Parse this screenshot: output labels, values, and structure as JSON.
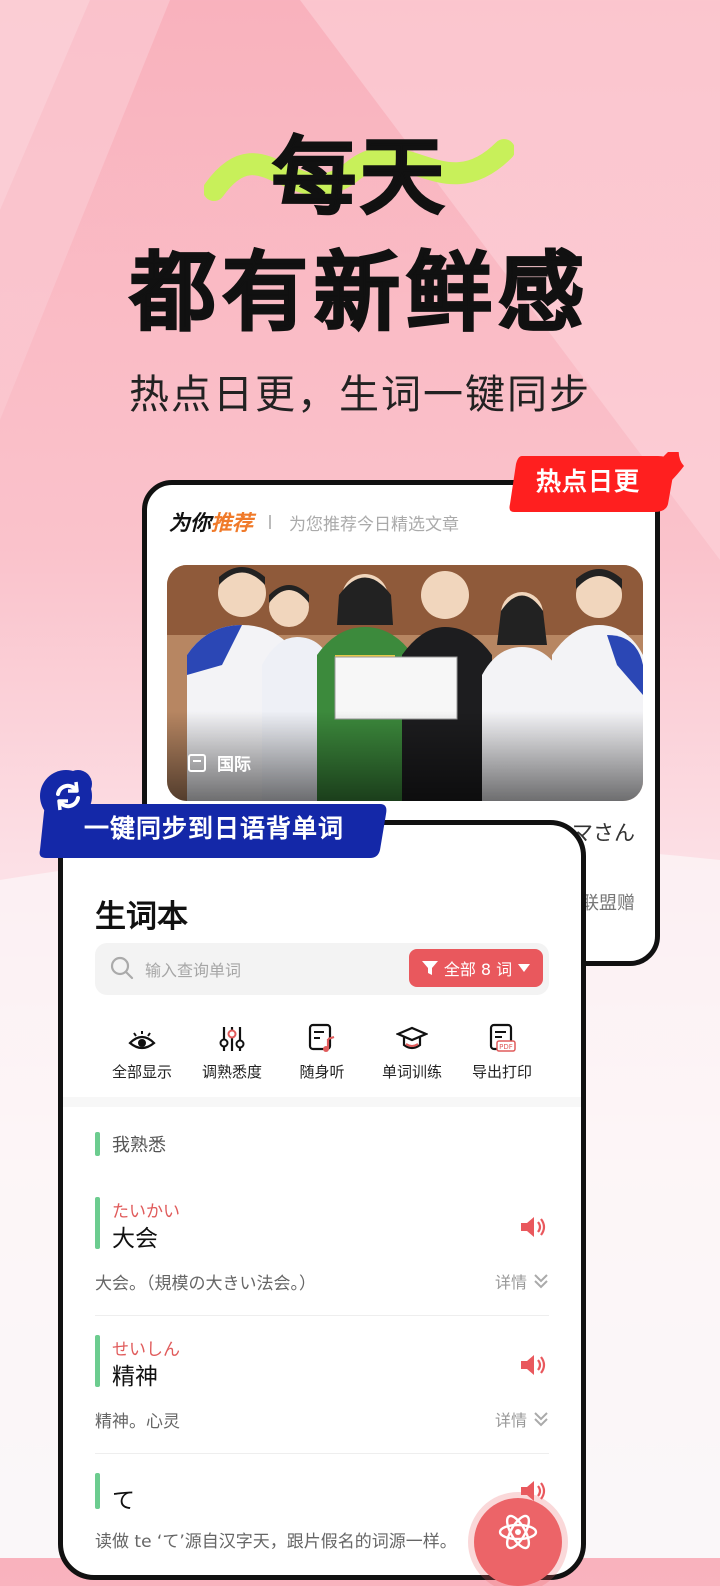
{
  "hero": {
    "line1": "每天",
    "line2": "都有新鲜感",
    "subtitle": "热点日更，生词一键同步"
  },
  "badges": {
    "hot": "热点日更",
    "sync": "一键同步到日语背单词"
  },
  "recommend": {
    "title_a": "为你",
    "title_b": "推荐",
    "desc": "为您推荐今日精选文章",
    "category": "国际",
    "peek_line1": "マさん",
    "peek_line2": "联盟赠"
  },
  "vocab": {
    "title": "生词本",
    "search_placeholder": "输入查询单词",
    "filter_label": "全部 8 词",
    "tools": [
      {
        "label": "全部显示",
        "icon": "eye-icon"
      },
      {
        "label": "调熟悉度",
        "icon": "sliders-icon"
      },
      {
        "label": "随身听",
        "icon": "music-note-icon"
      },
      {
        "label": "单词训练",
        "icon": "graduation-cap-icon"
      },
      {
        "label": "导出打印",
        "icon": "pdf-icon"
      }
    ],
    "group_label": "我熟悉",
    "detail_label": "详情",
    "words": [
      {
        "kana": "たいかい",
        "term": "大会",
        "meaning": "大会。（規模の大きい法会。）"
      },
      {
        "kana": "せいしん",
        "term": "精神",
        "meaning": "精神。心灵"
      },
      {
        "kana": "",
        "term": "て",
        "meaning": "读做 te ‘て’源自汉字天，跟片假名的词源一样。"
      }
    ]
  },
  "colors": {
    "accent_red": "#e9585d",
    "hot_badge": "#ff1f1f",
    "sync_badge": "#1428a8",
    "known_green": "#6ccc8f",
    "swoosh": "#c8f05a"
  }
}
